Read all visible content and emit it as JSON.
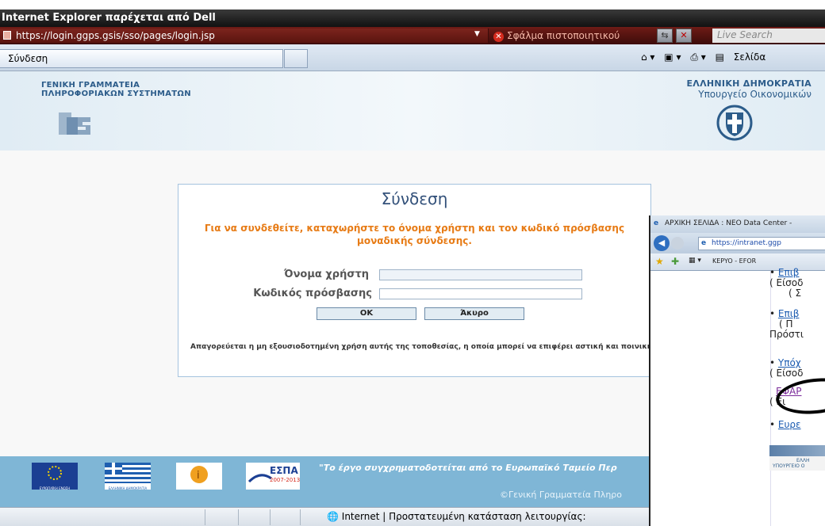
{
  "window": {
    "title": "Internet Explorer παρέχεται από Dell",
    "address": "https://login.ggps.gsis/sso/pages/login.jsp",
    "cert_error": "Σφάλμα πιστοποιητικού",
    "search_placeholder": "Live Search"
  },
  "tabs": [
    {
      "label": "Σύνδεση"
    }
  ],
  "command_bar": {
    "page_label": "Σελίδα"
  },
  "header": {
    "org_line1": "ΓΕΝΙΚΗ ΓΡΑΜΜΑΤΕΙΑ",
    "org_line2": "ΠΛΗΡΟΦΟΡΙΑΚΩΝ ΣΥΣΤΗΜΑΤΩΝ",
    "state": "ΕΛΛΗΝΙΚΗ ΔΗΜΟΚΡΑΤΙΑ",
    "ministry": "Υπουργείο Οικονομικών"
  },
  "login": {
    "title": "Σύνδεση",
    "message": "Για να συνδεθείτε, καταχωρήστε το όνομα χρήστη και τον κωδικό πρόσβασης μοναδικής σύνδεσης.",
    "username_label": "Όνομα χρήστη",
    "username_value": "",
    "password_label": "Κωδικός πρόσβασης",
    "password_value": "",
    "ok_label": "OK",
    "cancel_label": "Άκυρο",
    "warning": "Απαγορεύεται η μη εξουσιοδοτημένη χρήση αυτής της τοποθεσίας, η οποία μπορεί να επιφέρει αστική και ποινική δίωξη."
  },
  "footer": {
    "logos": [
      {
        "name": "eu-flag",
        "caption": "ΕΥΡΩΠΑΪΚΗ ΕΝΩΣΗ"
      },
      {
        "name": "greek-flag",
        "caption": "ΕΛΛΗΝΙΚΗ ΔΗΜΟΚΡΑΤΙΑ"
      },
      {
        "name": "info-society",
        "caption": ""
      },
      {
        "name": "espa",
        "caption": "ΕΣΠΑ 2007-2013"
      }
    ],
    "quote": "\"Το έργο συγχρηματοδοτείται από το Ευρωπαϊκό Ταμείο Περ",
    "copyright": "©Γενική Γραμματεία Πληρο"
  },
  "status": {
    "zone": "Internet | Προστατευμένη κατάσταση λειτουργίας:"
  },
  "window2": {
    "title": "ΑΡΧΙΚΗ ΣΕΛΙΔΑ : NEO Data Center -",
    "address": "https://intranet.ggp",
    "fav_tab": "KEPYO - EFOR",
    "items": [
      {
        "bullet": "• ",
        "link": "Επιβ",
        "line2": "( Είσοδ",
        "line3": "( Σ"
      },
      {
        "bullet": "• ",
        "link": "Επιβ",
        "line2": "( Π",
        "line3": "Πρόστι"
      },
      {
        "bullet": "• ",
        "link": "Υπόχ",
        "line2": "( Είσοδ",
        "line3": ""
      },
      {
        "bullet": "",
        "link": "ΕΦΑΡ",
        "line2": "( Ει",
        "line3": ""
      },
      {
        "bullet": "• ",
        "link": "Ευρε",
        "line2": "",
        "line3": ""
      }
    ],
    "banner": "ΕΛΛΗ",
    "banner2": "ΥΠΟΥΡΓΕΙΟ Ο"
  },
  "colors": {
    "accent": "#e77b15",
    "brand": "#2c5c8a",
    "footer": "#7fb6d6"
  }
}
